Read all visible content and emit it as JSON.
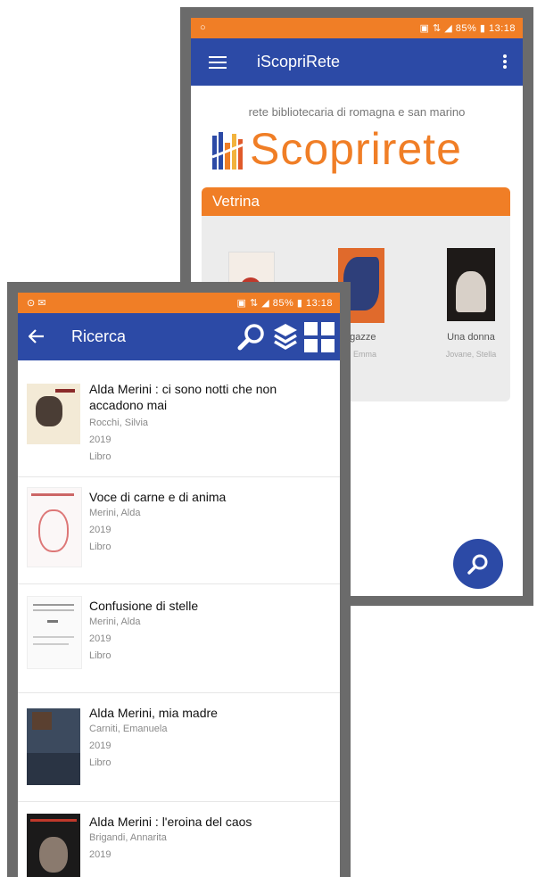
{
  "back_screen": {
    "status_right": "▣ ⇅ ◢ 85% ▮ 13:18",
    "app_title": "iScopriRete",
    "tagline": "rete bibliotecaria di romagna e san marino",
    "logo_text": "Scoprirete",
    "vetrina_label": "Vetrina",
    "vetrina_items": [
      {
        "title": "",
        "author": ""
      },
      {
        "title": "agazze",
        "author": "a, Emma"
      },
      {
        "title": "Una donna",
        "author": "Jovane, Stella"
      }
    ]
  },
  "front_screen": {
    "status_right": "▣ ⇅ ◢ 85% ▮ 13:18",
    "title": "Ricerca",
    "results": [
      {
        "title": "Alda Merini : ci sono notti che non accadono mai",
        "author": "Rocchi, Silvia",
        "year": "2019",
        "type": "Libro"
      },
      {
        "title": "Voce di carne e di anima",
        "author": "Merini, Alda",
        "year": "2019",
        "type": "Libro"
      },
      {
        "title": "Confusione di stelle",
        "author": "Merini, Alda",
        "year": "2019",
        "type": "Libro"
      },
      {
        "title": "Alda Merini, mia madre",
        "author": "Carniti, Emanuela",
        "year": "2019",
        "type": "Libro"
      },
      {
        "title": "Alda Merini : l'eroina del caos",
        "author": "Brigandi, Annarita",
        "year": "2019",
        "type": ""
      }
    ]
  },
  "colors": {
    "accent_orange": "#f07e26",
    "primary_blue": "#2c4aa6"
  }
}
